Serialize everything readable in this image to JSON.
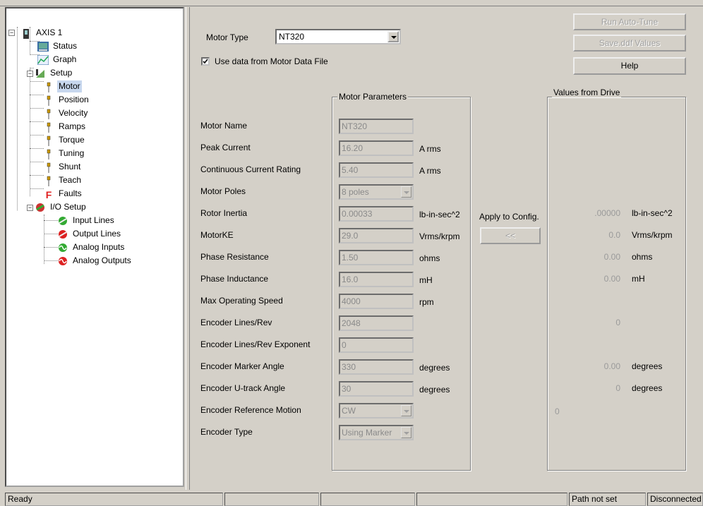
{
  "tree": {
    "root": "AXIS 1",
    "items": [
      {
        "label": "Status",
        "icon": "status-icon"
      },
      {
        "label": "Graph",
        "icon": "graph-icon"
      },
      {
        "label": "Setup",
        "icon": "setup-icon"
      },
      {
        "label": "Motor",
        "icon": "pin-icon",
        "selected": true
      },
      {
        "label": "Position",
        "icon": "pin-icon"
      },
      {
        "label": "Velocity",
        "icon": "pin-icon"
      },
      {
        "label": "Ramps",
        "icon": "pin-icon"
      },
      {
        "label": "Torque",
        "icon": "pin-icon"
      },
      {
        "label": "Tuning",
        "icon": "pin-icon"
      },
      {
        "label": "Shunt",
        "icon": "pin-icon"
      },
      {
        "label": "Teach",
        "icon": "pin-icon"
      },
      {
        "label": "Faults",
        "icon": "faults-icon"
      },
      {
        "label": "I/O Setup",
        "icon": "io-setup-icon"
      },
      {
        "label": "Input Lines",
        "icon": "input-lines-icon"
      },
      {
        "label": "Output Lines",
        "icon": "output-lines-icon"
      },
      {
        "label": "Analog Inputs",
        "icon": "analog-inputs-icon"
      },
      {
        "label": "Analog Outputs",
        "icon": "analog-outputs-icon"
      }
    ]
  },
  "motor_type": {
    "label": "Motor Type",
    "value": "NT320"
  },
  "checkbox": {
    "label": "Use data from Motor Data File",
    "checked": true
  },
  "buttons": {
    "auto_tune": "Run Auto-Tune",
    "save_ddf": "Save.ddf Values",
    "help": "Help",
    "apply": "<<"
  },
  "apply_label": "Apply to Config.",
  "motor_params_title": "Motor Parameters",
  "drive_values_title": "Values from Drive",
  "params": [
    {
      "label": "Motor Name",
      "value": "NT320",
      "unit": "",
      "drive": "",
      "drive_unit": ""
    },
    {
      "label": "Peak Current",
      "value": "16.20",
      "unit": "A rms",
      "drive": "",
      "drive_unit": ""
    },
    {
      "label": "Continuous Current Rating",
      "value": "5.40",
      "unit": "A rms",
      "drive": "",
      "drive_unit": ""
    },
    {
      "label": "Motor Poles",
      "value": "8 poles",
      "unit": "",
      "drive": "",
      "drive_unit": "",
      "combo": true
    },
    {
      "label": "Rotor Inertia",
      "value": "0.00033",
      "unit": "lb-in-sec^2",
      "drive": ".00000",
      "drive_unit": "lb-in-sec^2"
    },
    {
      "label": "MotorKE",
      "value": "29.0",
      "unit": "Vrms/krpm",
      "drive": "0.0",
      "drive_unit": "Vrms/krpm"
    },
    {
      "label": "Phase Resistance",
      "value": "1.50",
      "unit": "ohms",
      "drive": "0.00",
      "drive_unit": "ohms"
    },
    {
      "label": "Phase Inductance",
      "value": "16.0",
      "unit": "mH",
      "drive": "0.00",
      "drive_unit": "mH"
    },
    {
      "label": "Max Operating Speed",
      "value": "4000",
      "unit": "rpm",
      "drive": "",
      "drive_unit": ""
    },
    {
      "label": "Encoder Lines/Rev",
      "value": "2048",
      "unit": "",
      "drive": "0",
      "drive_unit": ""
    },
    {
      "label": "Encoder Lines/Rev Exponent",
      "value": "0",
      "unit": "",
      "drive": "",
      "drive_unit": ""
    },
    {
      "label": "Encoder Marker Angle",
      "value": "330",
      "unit": "degrees",
      "drive": "0.00",
      "drive_unit": "degrees"
    },
    {
      "label": "Encoder U-track Angle",
      "value": "30",
      "unit": "degrees",
      "drive": "0",
      "drive_unit": "degrees"
    },
    {
      "label": "Encoder Reference Motion",
      "value": "CW",
      "unit": "",
      "drive": "",
      "drive_unit": "",
      "combo": true,
      "left_drive": "0"
    },
    {
      "label": "Encoder Type",
      "value": "Using Marker",
      "unit": "",
      "drive": "",
      "drive_unit": "",
      "combo": true
    }
  ],
  "status_bar": {
    "ready": "Ready",
    "path": "Path not set",
    "connection": "Disconnected"
  }
}
